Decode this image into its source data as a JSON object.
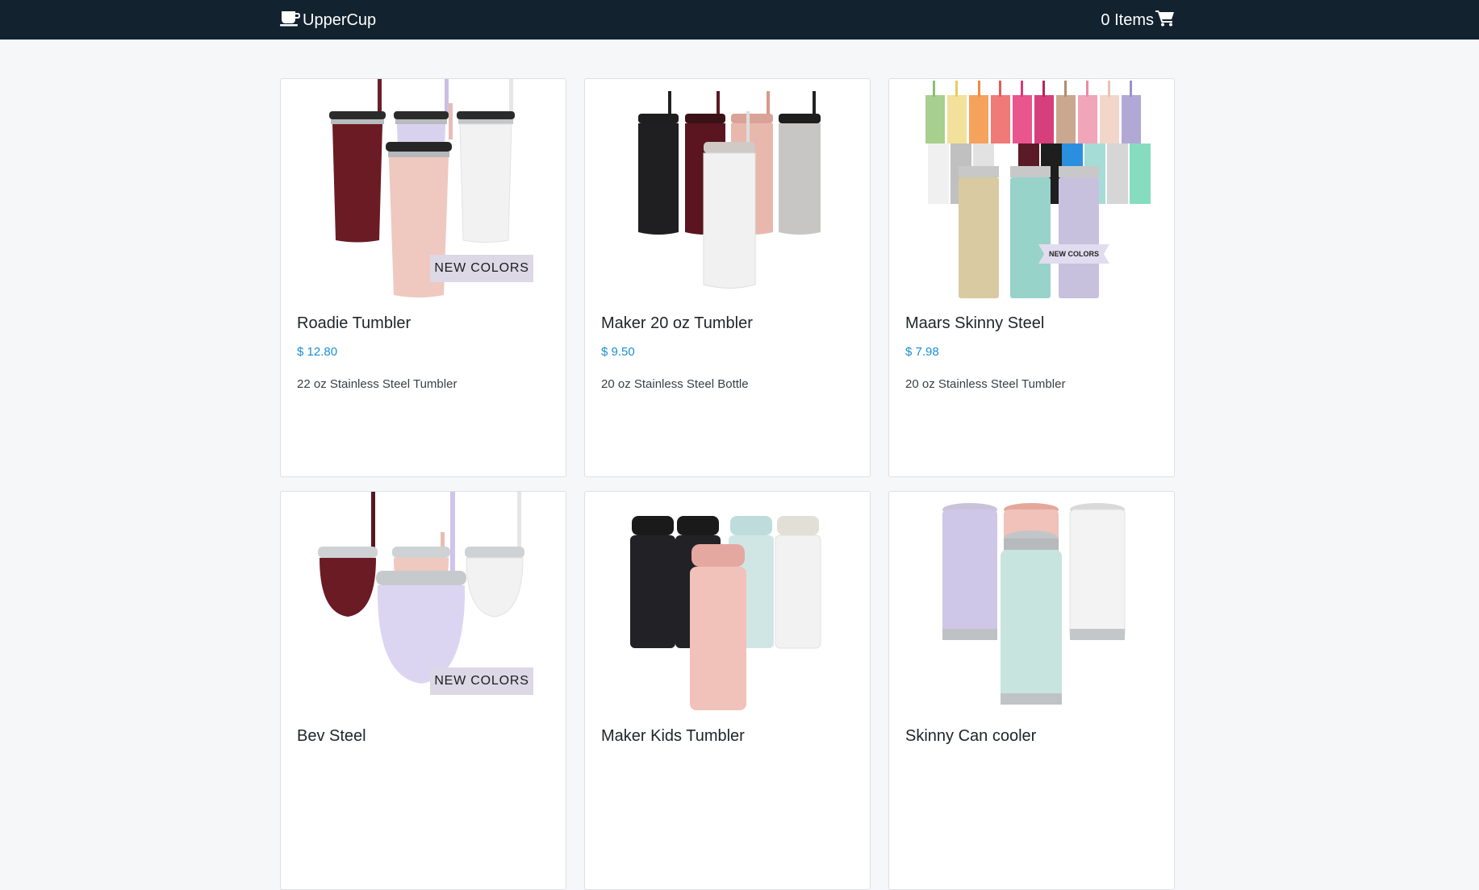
{
  "header": {
    "brand_name": "UpperCup",
    "brand_icon": "cup-icon",
    "cart_label": "0 Items",
    "cart_icon": "shopping-cart-icon",
    "background_color": "#12222f"
  },
  "price_color": "#1b8fd0",
  "products": [
    {
      "title": "Roadie Tumbler",
      "price": "$ 12.80",
      "description": "22 oz Stainless Steel Tumbler",
      "badge": "NEW COLORS"
    },
    {
      "title": "Maker 20 oz Tumbler",
      "price": "$ 9.50",
      "description": "20 oz Stainless Steel Bottle"
    },
    {
      "title": "Maars Skinny Steel",
      "price": "$ 7.98",
      "description": "20 oz Stainless Steel Tumbler",
      "badge": "NEW COLORS"
    },
    {
      "title": "Bev Steel",
      "badge": "NEW COLORS"
    },
    {
      "title": "Maker Kids Tumbler"
    },
    {
      "title": "Skinny Can cooler"
    }
  ]
}
